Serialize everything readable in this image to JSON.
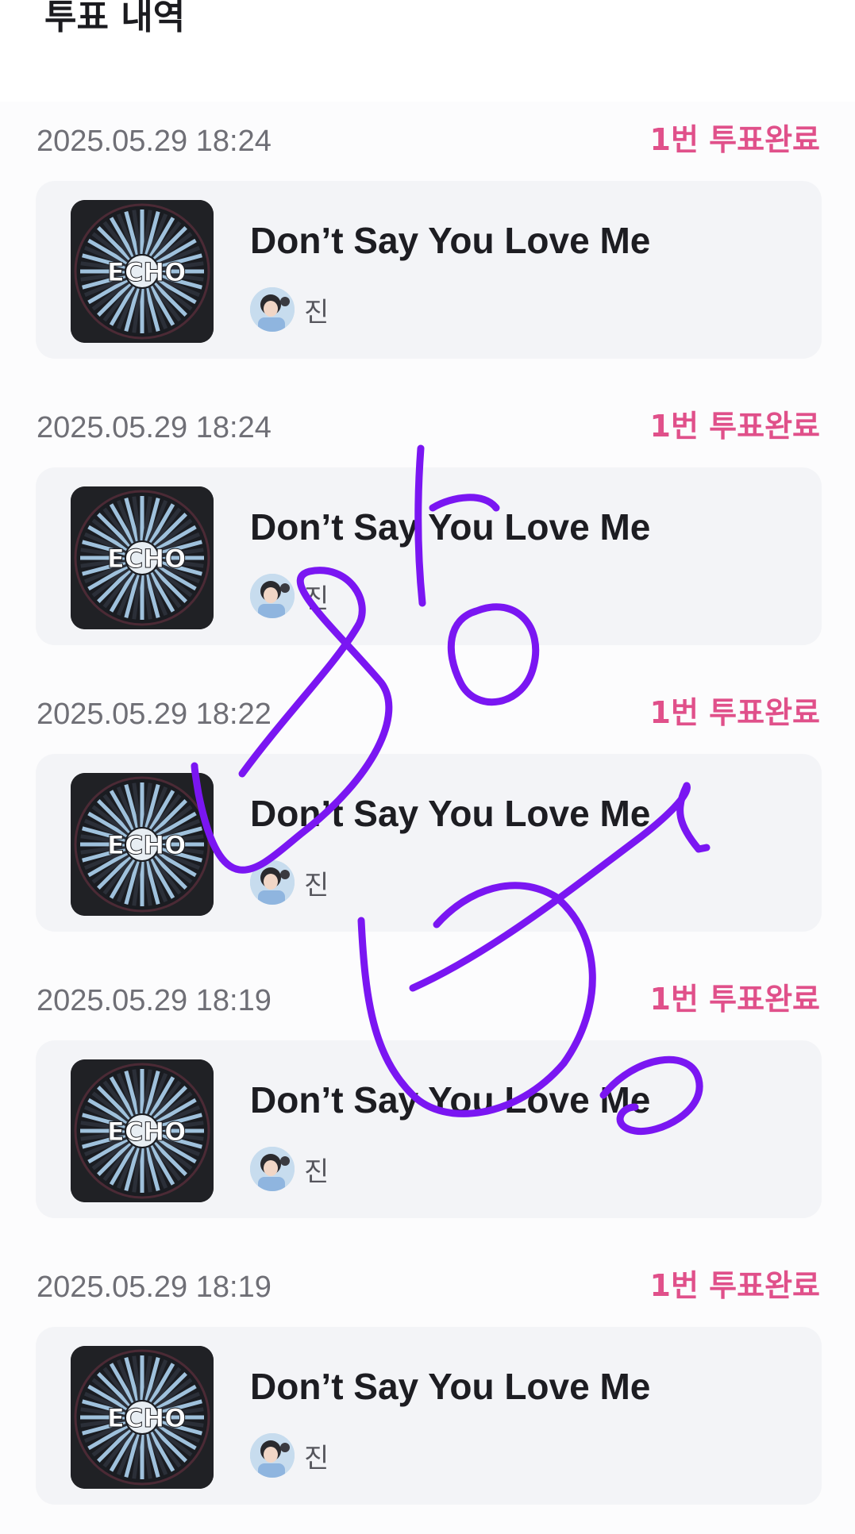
{
  "header": {
    "title": "투표 내역"
  },
  "colors": {
    "accent": "#e0508a",
    "scribble": "#7a16f2"
  },
  "votes": [
    {
      "timestamp": "2025.05.29 18:24",
      "status": "1번 투표완료",
      "song": "Don’t Say You Love Me",
      "artist": "진",
      "album_text": "ECHO"
    },
    {
      "timestamp": "2025.05.29 18:24",
      "status": "1번 투표완료",
      "song": "Don’t Say You Love Me",
      "artist": "진",
      "album_text": "ECHO"
    },
    {
      "timestamp": "2025.05.29 18:22",
      "status": "1번 투표완료",
      "song": "Don’t Say You Love Me",
      "artist": "진",
      "album_text": "ECHO"
    },
    {
      "timestamp": "2025.05.29 18:19",
      "status": "1번 투표완료",
      "song": "Don’t Say You Love Me",
      "artist": "진",
      "album_text": "ECHO"
    },
    {
      "timestamp": "2025.05.29 18:19",
      "status": "1번 투표완료",
      "song": "Don’t Say You Love Me",
      "artist": "진",
      "album_text": "ECHO"
    }
  ]
}
